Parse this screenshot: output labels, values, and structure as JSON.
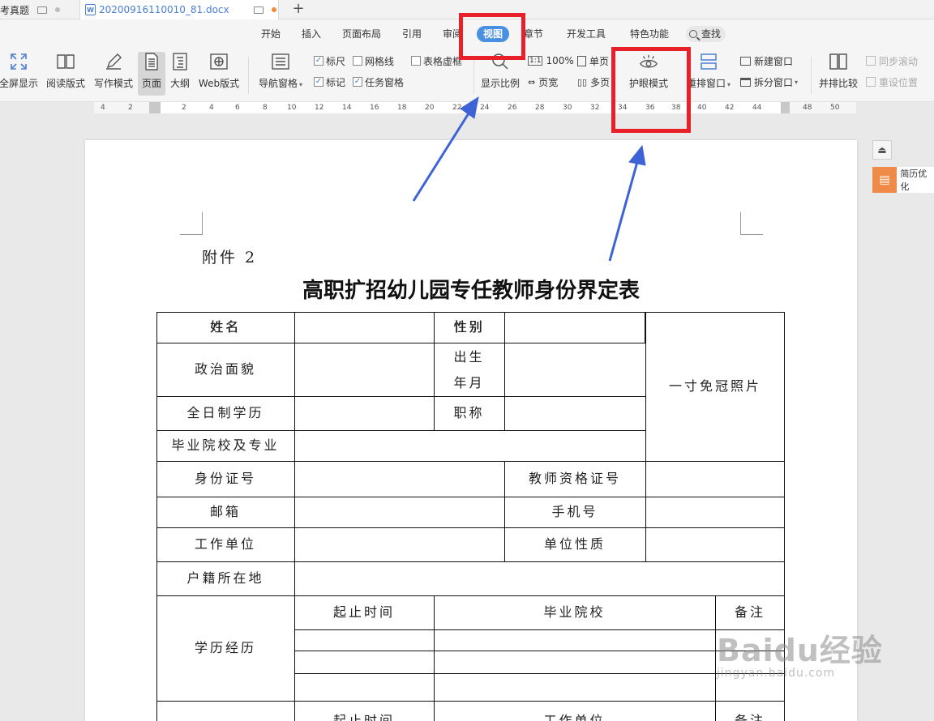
{
  "tabs": [
    {
      "label": "考真题"
    },
    {
      "label": "20200916110010_81.docx"
    }
  ],
  "menu": [
    "开始",
    "插入",
    "页面布局",
    "引用",
    "审阅",
    "视图",
    "章节",
    "开发工具",
    "特色功能",
    "查找"
  ],
  "ribbon": {
    "fullscreen": "全屏显示",
    "read": "阅读版式",
    "write": "写作模式",
    "page": "页面",
    "outline": "大纲",
    "web": "Web版式",
    "nav": "导航窗格",
    "ruler": "标尺",
    "grid": "网格线",
    "table_virtual": "表格虚框",
    "mark": "标记",
    "task": "任务窗格",
    "zoom": "显示比例",
    "hundred": "100%",
    "page_width": "页宽",
    "single": "单页",
    "multi": "多页",
    "eye": "护眼模式",
    "arrange": "重排窗口",
    "new_window": "新建窗口",
    "split": "拆分窗口",
    "compare": "并排比较",
    "sync_scroll": "同步滚动",
    "reset_pos": "重设位置"
  },
  "ruler_numbers": [
    "4",
    "2",
    "2",
    "4",
    "6",
    "8",
    "10",
    "12",
    "14",
    "16",
    "18",
    "20",
    "22",
    "24",
    "26",
    "28",
    "30",
    "32",
    "34",
    "36",
    "38",
    "40",
    "42",
    "44",
    "48",
    "50"
  ],
  "document": {
    "attachment": "附件 2",
    "title": "高职扩招幼儿园专任教师身份界定表",
    "cells": {
      "name": "姓名",
      "gender": "性别",
      "photo": "一寸免冠照片",
      "politics": "政治面貌",
      "birth1": "出生",
      "birth2": "年月",
      "education": "全日制学历",
      "title": "职称",
      "school_major": "毕业院校及专业",
      "id": "身份证号",
      "teacher_cert": "教师资格证号",
      "email": "邮箱",
      "phone": "手机号",
      "work_unit": "工作单位",
      "unit_nature": "单位性质",
      "hukou": "户籍所在地",
      "edu_history": "学历经历",
      "start_end": "起止时间",
      "grad_school": "毕业院校",
      "remark": "备注",
      "start_end2": "起止时间",
      "work_unit2": "工作单位",
      "remark2": "备注"
    }
  },
  "side": {
    "resume": "简历优化"
  },
  "watermark": {
    "brand": "Baidu经验",
    "url": "jingyan.baidu.com"
  },
  "colors": {
    "highlight": "#e8202a",
    "arrow": "#3d63d6",
    "active_menu": "#4a90e2"
  }
}
